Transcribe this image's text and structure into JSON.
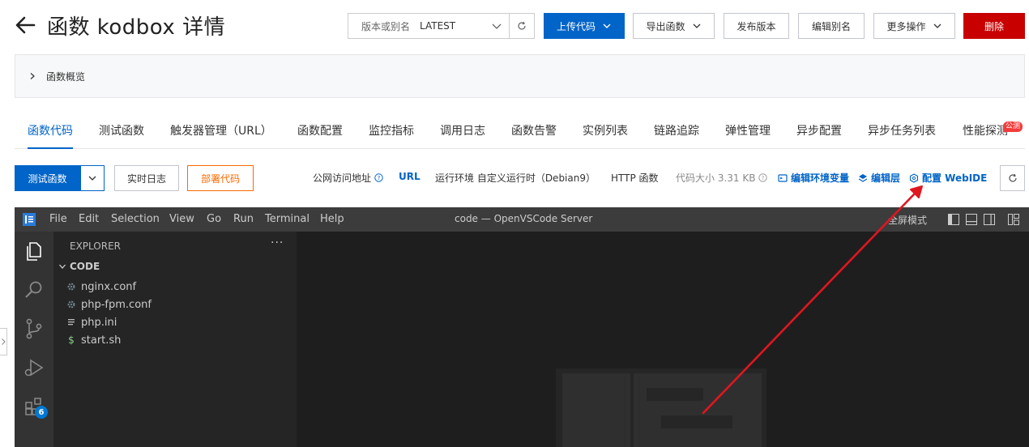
{
  "header": {
    "title": "函数 kodbox 详情",
    "version_select": {
      "label": "版本或别名",
      "value": "LATEST"
    },
    "buttons": {
      "upload_code": "上传代码",
      "export_function": "导出函数",
      "publish_version": "发布版本",
      "edit_alias": "编辑别名",
      "more_actions": "更多操作",
      "delete": "删除"
    }
  },
  "overview": {
    "label": "函数概览"
  },
  "tabs": [
    {
      "label": "函数代码",
      "active": true
    },
    {
      "label": "测试函数"
    },
    {
      "label": "触发器管理（URL）"
    },
    {
      "label": "函数配置"
    },
    {
      "label": "监控指标"
    },
    {
      "label": "调用日志"
    },
    {
      "label": "函数告警"
    },
    {
      "label": "实例列表"
    },
    {
      "label": "链路追踪"
    },
    {
      "label": "弹性管理"
    },
    {
      "label": "异步配置"
    },
    {
      "label": "异步任务列表"
    },
    {
      "label": "性能探测",
      "badge": "公测"
    }
  ],
  "toolbar": {
    "test_function": "测试函数",
    "realtime_log": "实时日志",
    "deploy_code": "部署代码",
    "public_url_label": "公网访问地址",
    "url_link": "URL",
    "runtime": "运行环境 自定义运行时（Debian9）",
    "http_function": "HTTP 函数",
    "code_size": "代码大小 3.31 KB",
    "edit_env": "编辑环境变量",
    "edit_layer": "编辑层",
    "config_webide": "配置 WebIDE"
  },
  "vscode": {
    "menu": [
      "File",
      "Edit",
      "Selection",
      "View",
      "Go",
      "Run",
      "Terminal",
      "Help"
    ],
    "window_title": "code — OpenVSCode Server",
    "fullscreen": "全屏模式",
    "explorer_title": "EXPLORER",
    "explorer_more": "···",
    "folder": "CODE",
    "files": [
      {
        "name": "nginx.conf",
        "icon": "gear-icon"
      },
      {
        "name": "php-fpm.conf",
        "icon": "gear-icon"
      },
      {
        "name": "php.ini",
        "icon": "lines-icon"
      },
      {
        "name": "start.sh",
        "icon": "dollar-icon"
      }
    ],
    "extensions_badge": "6"
  },
  "colors": {
    "primary": "#0064c8",
    "danger": "#c80000",
    "orange": "#ff6a00",
    "annotation_arrow": "#e0161f"
  }
}
